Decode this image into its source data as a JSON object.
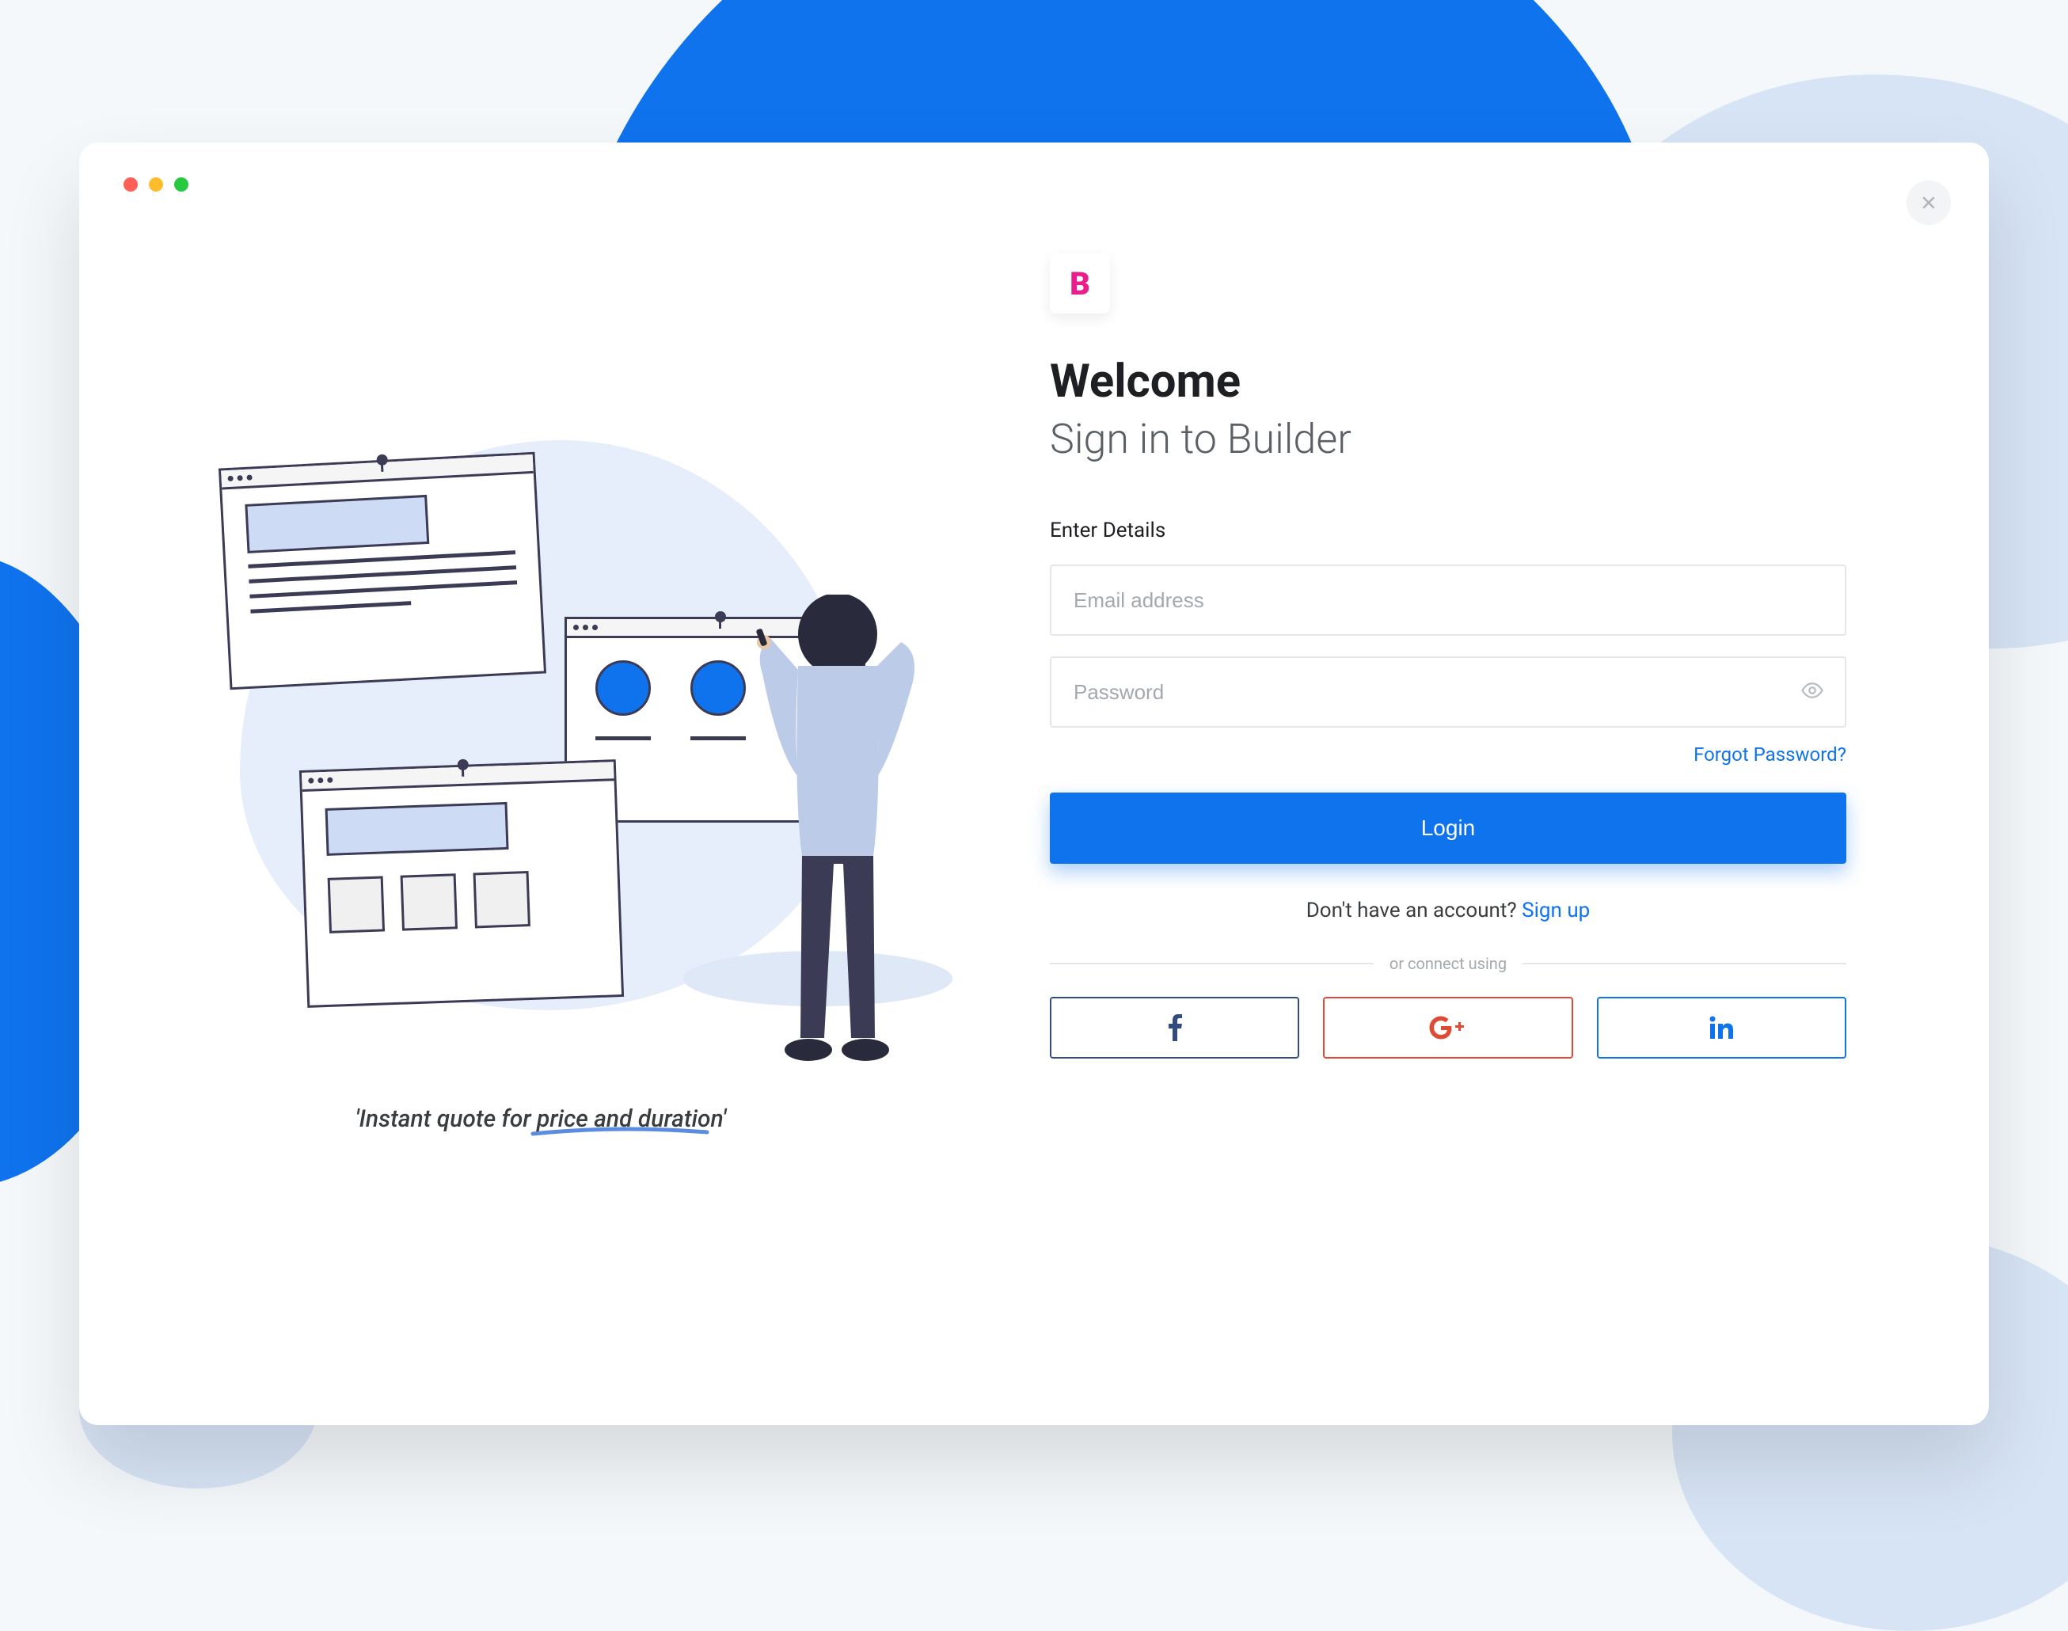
{
  "header": {
    "welcome": "Welcome",
    "subtitle": "Sign in to Builder"
  },
  "form": {
    "section_label": "Enter Details",
    "email_placeholder": "Email address",
    "password_placeholder": "Password",
    "forgot_link": "Forgot Password?",
    "login_button": "Login"
  },
  "signup": {
    "prompt": "Don't have an account? ",
    "link": "Sign up"
  },
  "divider_text": "or connect using",
  "illustration": {
    "tagline": "'Instant quote for price and duration'"
  },
  "logo_letter": "B",
  "social": {
    "facebook": "facebook",
    "google": "google-plus",
    "linkedin": "linkedin"
  }
}
